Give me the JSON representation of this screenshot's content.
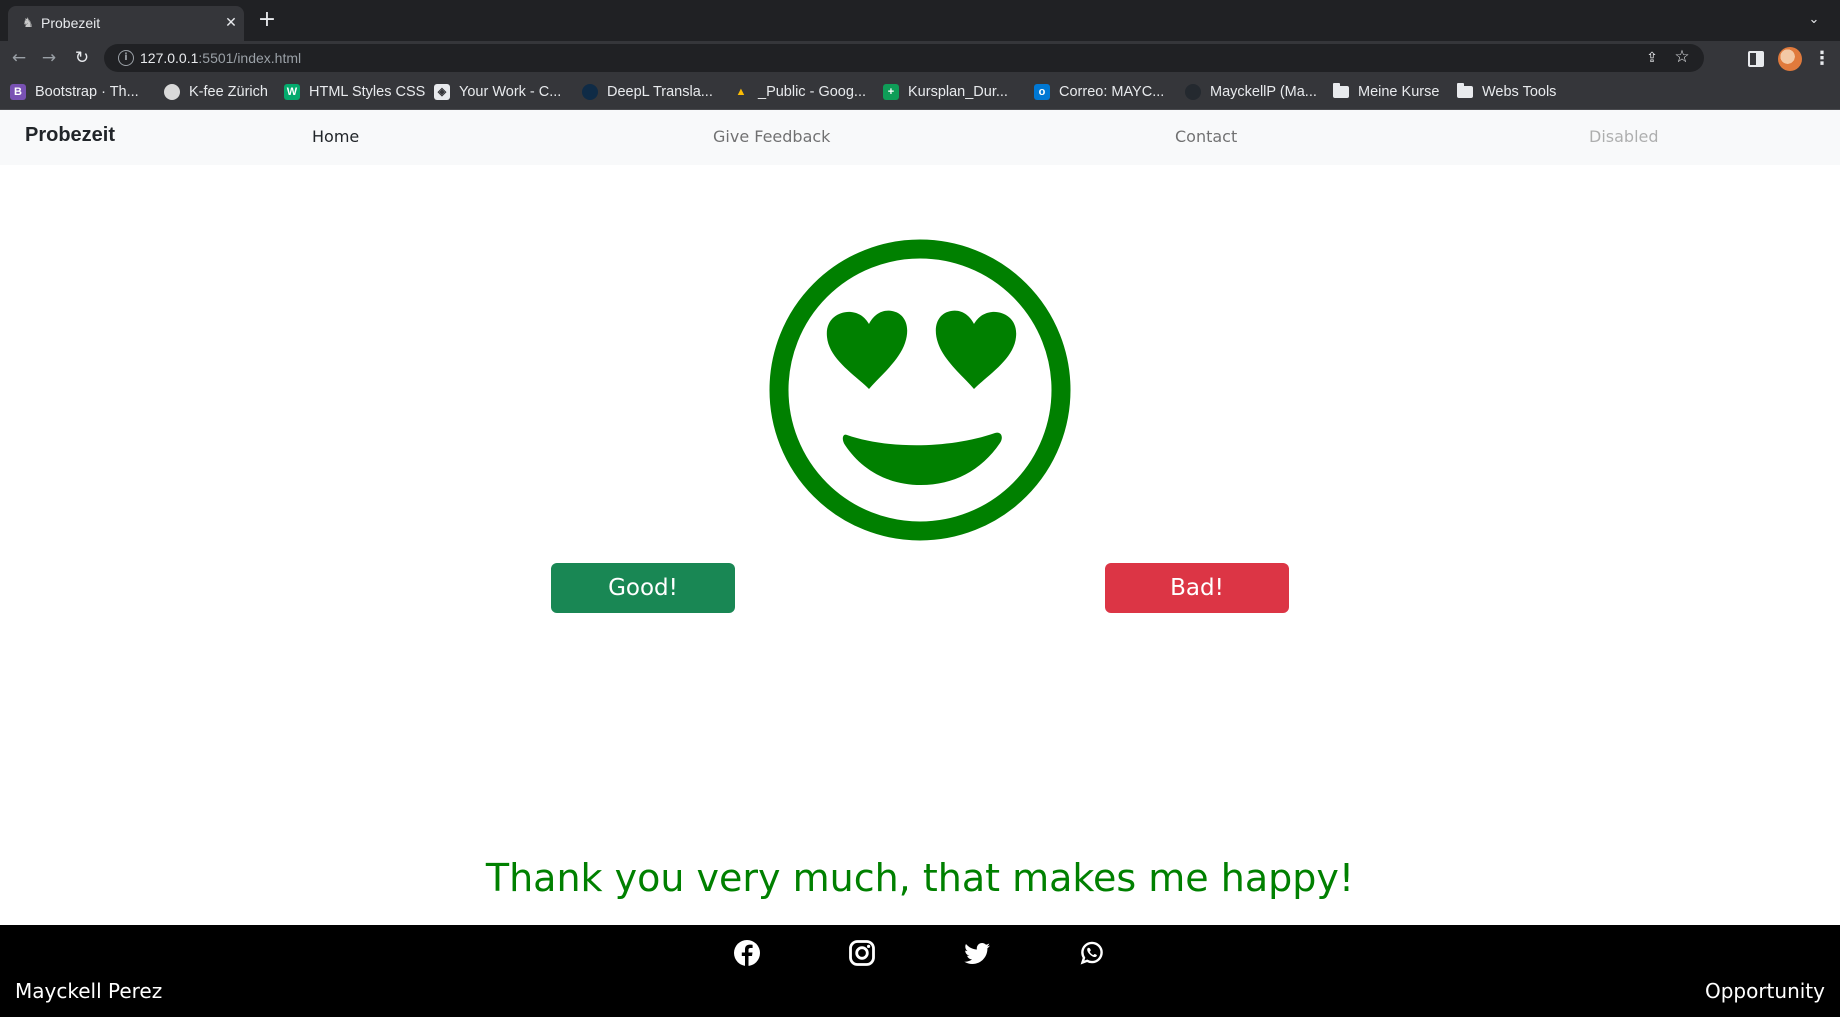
{
  "browser": {
    "tab": {
      "title": "Probezeit",
      "close_glyph": "✕",
      "favicon": "seal-icon"
    },
    "new_tab_glyph": "+",
    "tab_search_glyph": "⌄",
    "back_glyph": "←",
    "forward_glyph": "→",
    "reload_glyph": "↻",
    "address": {
      "host": "127.0.0.1",
      "path": ":5501/index.html"
    },
    "share_glyph": "⇪",
    "star_glyph": "☆",
    "menu_glyph": "⋮",
    "bookmarks": [
      {
        "label": "Bootstrap · Th...",
        "icon": "bootstrap-icon",
        "glyph": "B",
        "color": "#7952b3"
      },
      {
        "label": "K-fee Zürich",
        "icon": "kfee-icon",
        "glyph": "",
        "color": "#d9d9d9"
      },
      {
        "label": "HTML Styles CSS",
        "icon": "w3schools-icon",
        "glyph": "W",
        "color": "#04aa6d"
      },
      {
        "label": "Your Work - C...",
        "icon": "codepen-icon",
        "glyph": "◈",
        "color": "#e8eaed"
      },
      {
        "label": "DeepL Transla...",
        "icon": "deepl-icon",
        "glyph": "",
        "color": "#0f2b46"
      },
      {
        "label": "_Public - Goog...",
        "icon": "google-drive-icon",
        "glyph": "▲",
        "color": "#fbbc04"
      },
      {
        "label": "Kursplan_Dur...",
        "icon": "google-sheets-icon",
        "glyph": "+",
        "color": "#0f9d58"
      },
      {
        "label": "Correo: MAYC...",
        "icon": "outlook-icon",
        "glyph": "o",
        "color": "#0078d4"
      },
      {
        "label": "MayckellP (Ma...",
        "icon": "github-icon",
        "glyph": "",
        "color": "#24292f"
      },
      {
        "label": "Meine Kurse",
        "icon": "folder-icon",
        "glyph": "",
        "color": ""
      },
      {
        "label": "Webs Tools",
        "icon": "folder-icon",
        "glyph": "",
        "color": ""
      }
    ]
  },
  "navbar": {
    "brand": "Probezeit",
    "links": [
      {
        "label": "Home",
        "state": "active"
      },
      {
        "label": "Give Feedback",
        "state": "normal"
      },
      {
        "label": "Contact",
        "state": "normal"
      },
      {
        "label": "Disabled",
        "state": "disabled"
      }
    ]
  },
  "main": {
    "face_icon": "smiling-face-with-heart-eyes-icon",
    "face_color": "#008000",
    "good_label": "Good!",
    "bad_label": "Bad!",
    "message": "Thank you very much, that makes me happy!",
    "message_color": "#008000"
  },
  "footer": {
    "social": [
      "facebook-icon",
      "instagram-icon",
      "twitter-icon",
      "whatsapp-icon"
    ],
    "left_text": "Mayckell Perez",
    "right_text": "Opportunity"
  },
  "colors": {
    "good": "#198754",
    "bad": "#dc3545",
    "navbar_bg": "#f8f9fa",
    "footer_bg": "#000000"
  }
}
